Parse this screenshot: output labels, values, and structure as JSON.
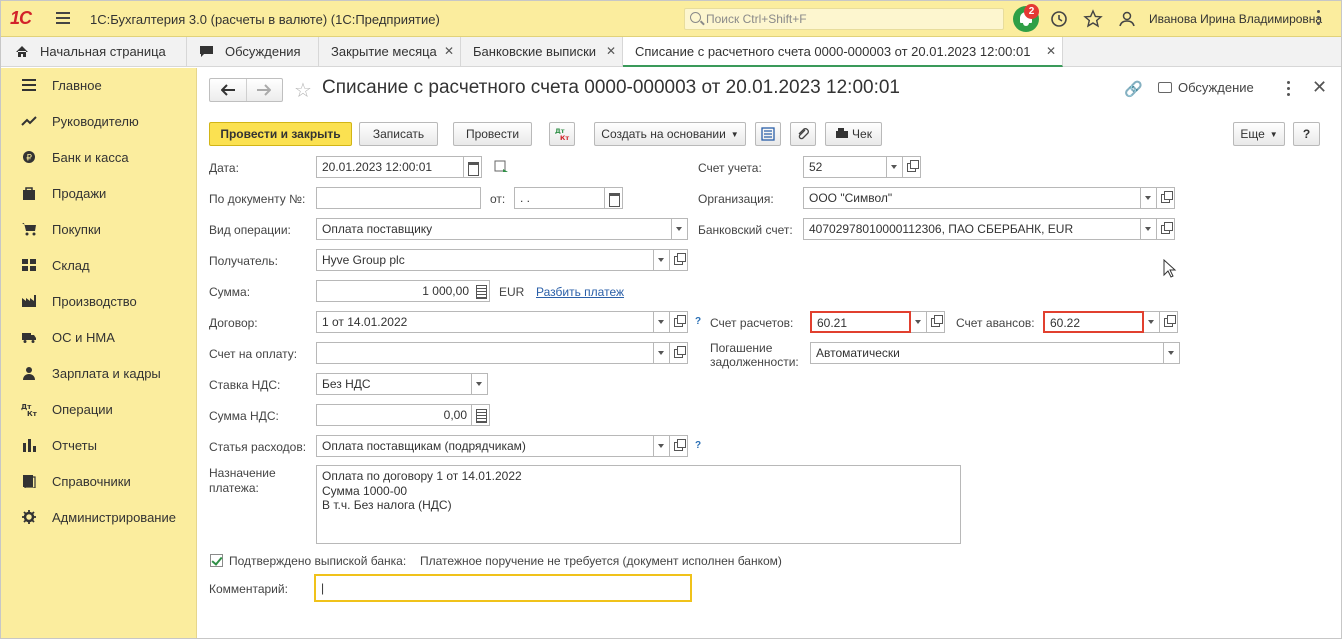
{
  "header": {
    "logo": "1С",
    "app_title": "1С:Бухгалтерия 3.0 (расчеты в валюте)  (1С:Предприятие)",
    "search_placeholder": "Поиск Ctrl+Shift+F",
    "notification_count": "2",
    "user_name": "Иванова Ирина Владимировна"
  },
  "tabs": [
    {
      "label": "Начальная страница"
    },
    {
      "label": "Обсуждения"
    },
    {
      "label": "Закрытие месяца"
    },
    {
      "label": "Банковские выписки"
    },
    {
      "label": "Списание с расчетного счета 0000-000003 от 20.01.2023 12:00:01"
    }
  ],
  "sidebar": {
    "items": [
      {
        "label": "Главное",
        "icon": "menu-lines-icon"
      },
      {
        "label": "Руководителю",
        "icon": "trend-icon"
      },
      {
        "label": "Банк и касса",
        "icon": "coin-icon"
      },
      {
        "label": "Продажи",
        "icon": "bag-icon"
      },
      {
        "label": "Покупки",
        "icon": "cart-icon"
      },
      {
        "label": "Склад",
        "icon": "warehouse-icon"
      },
      {
        "label": "Производство",
        "icon": "factory-icon"
      },
      {
        "label": "ОС и НМА",
        "icon": "truck-icon"
      },
      {
        "label": "Зарплата и кадры",
        "icon": "person-icon"
      },
      {
        "label": "Операции",
        "icon": "dt-kt-icon"
      },
      {
        "label": "Отчеты",
        "icon": "bar-chart-icon"
      },
      {
        "label": "Справочники",
        "icon": "books-icon"
      },
      {
        "label": "Администрирование",
        "icon": "gear-icon"
      }
    ]
  },
  "form": {
    "title": "Списание с расчетного счета 0000-000003 от 20.01.2023 12:00:01",
    "discussion_label": "Обсуждение",
    "toolbar": {
      "post_close": "Провести и закрыть",
      "save": "Записать",
      "post": "Провести",
      "dtkt": "Дт Кт",
      "create_based": "Создать на основании",
      "check": "Чек",
      "more": "Еще",
      "help": "?"
    },
    "fields": {
      "date_label": "Дата:",
      "date_value": "20.01.2023 12:00:01",
      "doc_no_label": "По документу №:",
      "doc_no_value": "",
      "from_label": "от:",
      "from_value": " .  .",
      "op_type_label": "Вид операции:",
      "op_type_value": "Оплата поставщику",
      "recipient_label": "Получатель:",
      "recipient_value": "Hyve Group plc",
      "sum_label": "Сумма:",
      "sum_value": "1 000,00",
      "currency": "EUR",
      "split_payment": "Разбить платеж",
      "contract_label": "Договор:",
      "contract_value": "1 от 14.01.2022",
      "invoice_label": "Счет на оплату:",
      "invoice_value": "",
      "vat_rate_label": "Ставка НДС:",
      "vat_rate_value": "Без НДС",
      "vat_sum_label": "Сумма НДС:",
      "vat_sum_value": "0,00",
      "expense_item_label": "Статья расходов:",
      "expense_item_value": "Оплата поставщикам (подрядчикам)",
      "purpose_label": "Назначение платежа:",
      "purpose_lines": [
        "Оплата по договору 1 от 14.01.2022",
        "Сумма 1000-00",
        "В т.ч. Без налога (НДС)"
      ],
      "account_label": "Счет учета:",
      "account_value": "52",
      "org_label": "Организация:",
      "org_value": "ООО \"Символ\"",
      "bank_account_label": "Банковский счет:",
      "bank_account_value": "40702978010000112306, ПАО СБЕРБАНК, EUR",
      "settle_account_label": "Счет расчетов:",
      "settle_account_value": "60.21",
      "advance_account_label": "Счет авансов:",
      "advance_account_value": "60.22",
      "debt_repay_label": "Погашение задолженности:",
      "debt_repay_value": "Автоматически",
      "confirmed_label": "Подтверждено выпиской банка:",
      "confirmed_note": "Платежное поручение не требуется (документ исполнен банком)",
      "comment_label": "Комментарий:",
      "comment_value": "|"
    }
  }
}
